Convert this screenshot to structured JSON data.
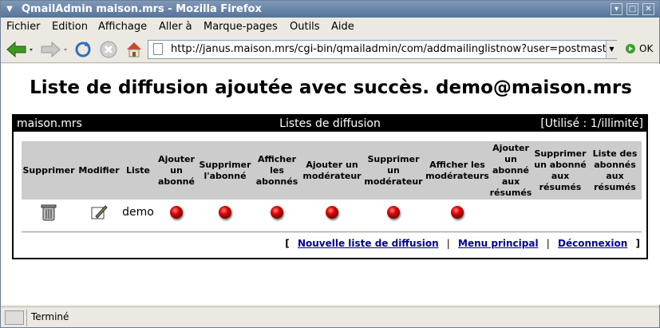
{
  "window": {
    "title": "QmailAdmin maison.mrs - Mozilla Firefox"
  },
  "menubar": {
    "items": [
      {
        "label": "Fichier"
      },
      {
        "label": "Edition"
      },
      {
        "label": "Affichage"
      },
      {
        "label": "Aller à"
      },
      {
        "label": "Marque-pages"
      },
      {
        "label": "Outils"
      },
      {
        "label": "Aide"
      }
    ]
  },
  "navbar": {
    "url": "http://janus.maison.mrs/cgi-bin/qmailadmin/com/addmailinglistnow?user=postmaste",
    "ok_label": "OK"
  },
  "page": {
    "heading": "Liste de diffusion ajoutée avec succès. demo@maison.mrs",
    "box": {
      "domain": "maison.mrs",
      "title": "Listes de diffusion",
      "usage": "[Utilisé : 1/illimité]"
    },
    "columns": [
      "Supprimer",
      "Modifier",
      "Liste",
      "Ajouter un abonné",
      "Supprimer l'abonné",
      "Afficher les abonnés",
      "Ajouter un modérateur",
      "Supprimer un modérateur",
      "Afficher les modérateurs",
      "Ajouter un abonné aux résumés",
      "Supprimer un abonné aux résumés",
      "Liste des abonnés aux résumés"
    ],
    "row": {
      "list_name": "demo"
    },
    "links": {
      "open": "[",
      "new_list": "Nouvelle liste de diffusion",
      "main_menu": "Menu principal",
      "logout": "Déconnexion",
      "close": "]",
      "divider": "|"
    }
  },
  "statusbar": {
    "text": "Terminé"
  },
  "colors": {
    "titlebar": "#56739a",
    "link": "#000099",
    "header_bg": "#000000",
    "grid_bg": "#cccccc"
  }
}
